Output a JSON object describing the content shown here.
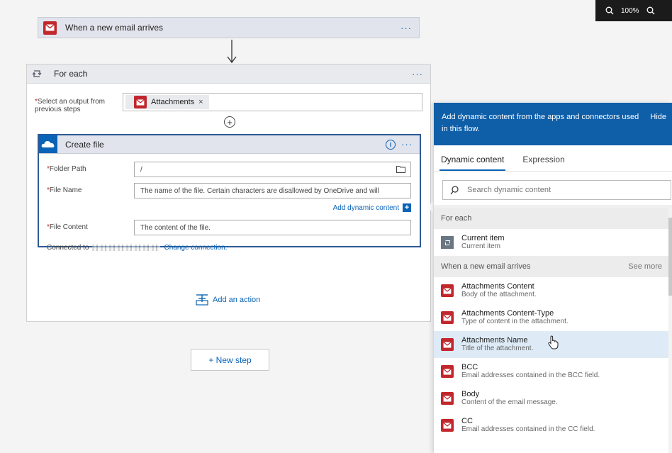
{
  "zoom": {
    "level": "100%"
  },
  "trigger": {
    "title": "When a new email arrives",
    "more": "···"
  },
  "foreach": {
    "title": "For each",
    "more": "···",
    "select_label": "Select an output from previous steps",
    "required_mark": "*",
    "token": {
      "label": "Attachments",
      "remove": "×"
    },
    "add_symbol": "+"
  },
  "create_file": {
    "title": "Create file",
    "more": "···",
    "info": "i",
    "fields": [
      {
        "label": "Folder Path",
        "value": "/"
      },
      {
        "label": "File Name",
        "value": "The name of the file. Certain characters are disallowed by OneDrive and will"
      },
      {
        "label": "File Content",
        "value": "The content of the file."
      }
    ],
    "add_dynamic": "Add dynamic content",
    "add_dynamic_plus": "+",
    "connected_to": "Connected to",
    "change_connection": "Change connection."
  },
  "add_action": "Add an action",
  "new_step": "+ New step",
  "panel": {
    "header": "Add dynamic content from the apps and connectors used in this flow.",
    "hide": "Hide",
    "tabs": [
      "Dynamic content",
      "Expression"
    ],
    "search_placeholder": "Search dynamic content",
    "sections": [
      {
        "title": "For each",
        "see_more": "",
        "items": [
          {
            "icon": "loop-icon",
            "title": "Current item",
            "desc": "Current item"
          }
        ]
      },
      {
        "title": "When a new email arrives",
        "see_more": "See more",
        "items": [
          {
            "icon": "outlook-icon",
            "title": "Attachments Content",
            "desc": "Body of the attachment."
          },
          {
            "icon": "outlook-icon",
            "title": "Attachments Content-Type",
            "desc": "Type of content in the attachment."
          },
          {
            "icon": "outlook-icon",
            "title": "Attachments Name",
            "desc": "Title of the attachment."
          },
          {
            "icon": "outlook-icon",
            "title": "BCC",
            "desc": "Email addresses contained in the BCC field."
          },
          {
            "icon": "outlook-icon",
            "title": "Body",
            "desc": "Content of the email message."
          },
          {
            "icon": "outlook-icon",
            "title": "CC",
            "desc": "Email addresses contained in the CC field."
          }
        ]
      }
    ]
  },
  "colors": {
    "accent": "#0a63b6",
    "panel_header": "#0f5ea8",
    "outlook": "#c1272d",
    "highlight": "#deebf7"
  }
}
